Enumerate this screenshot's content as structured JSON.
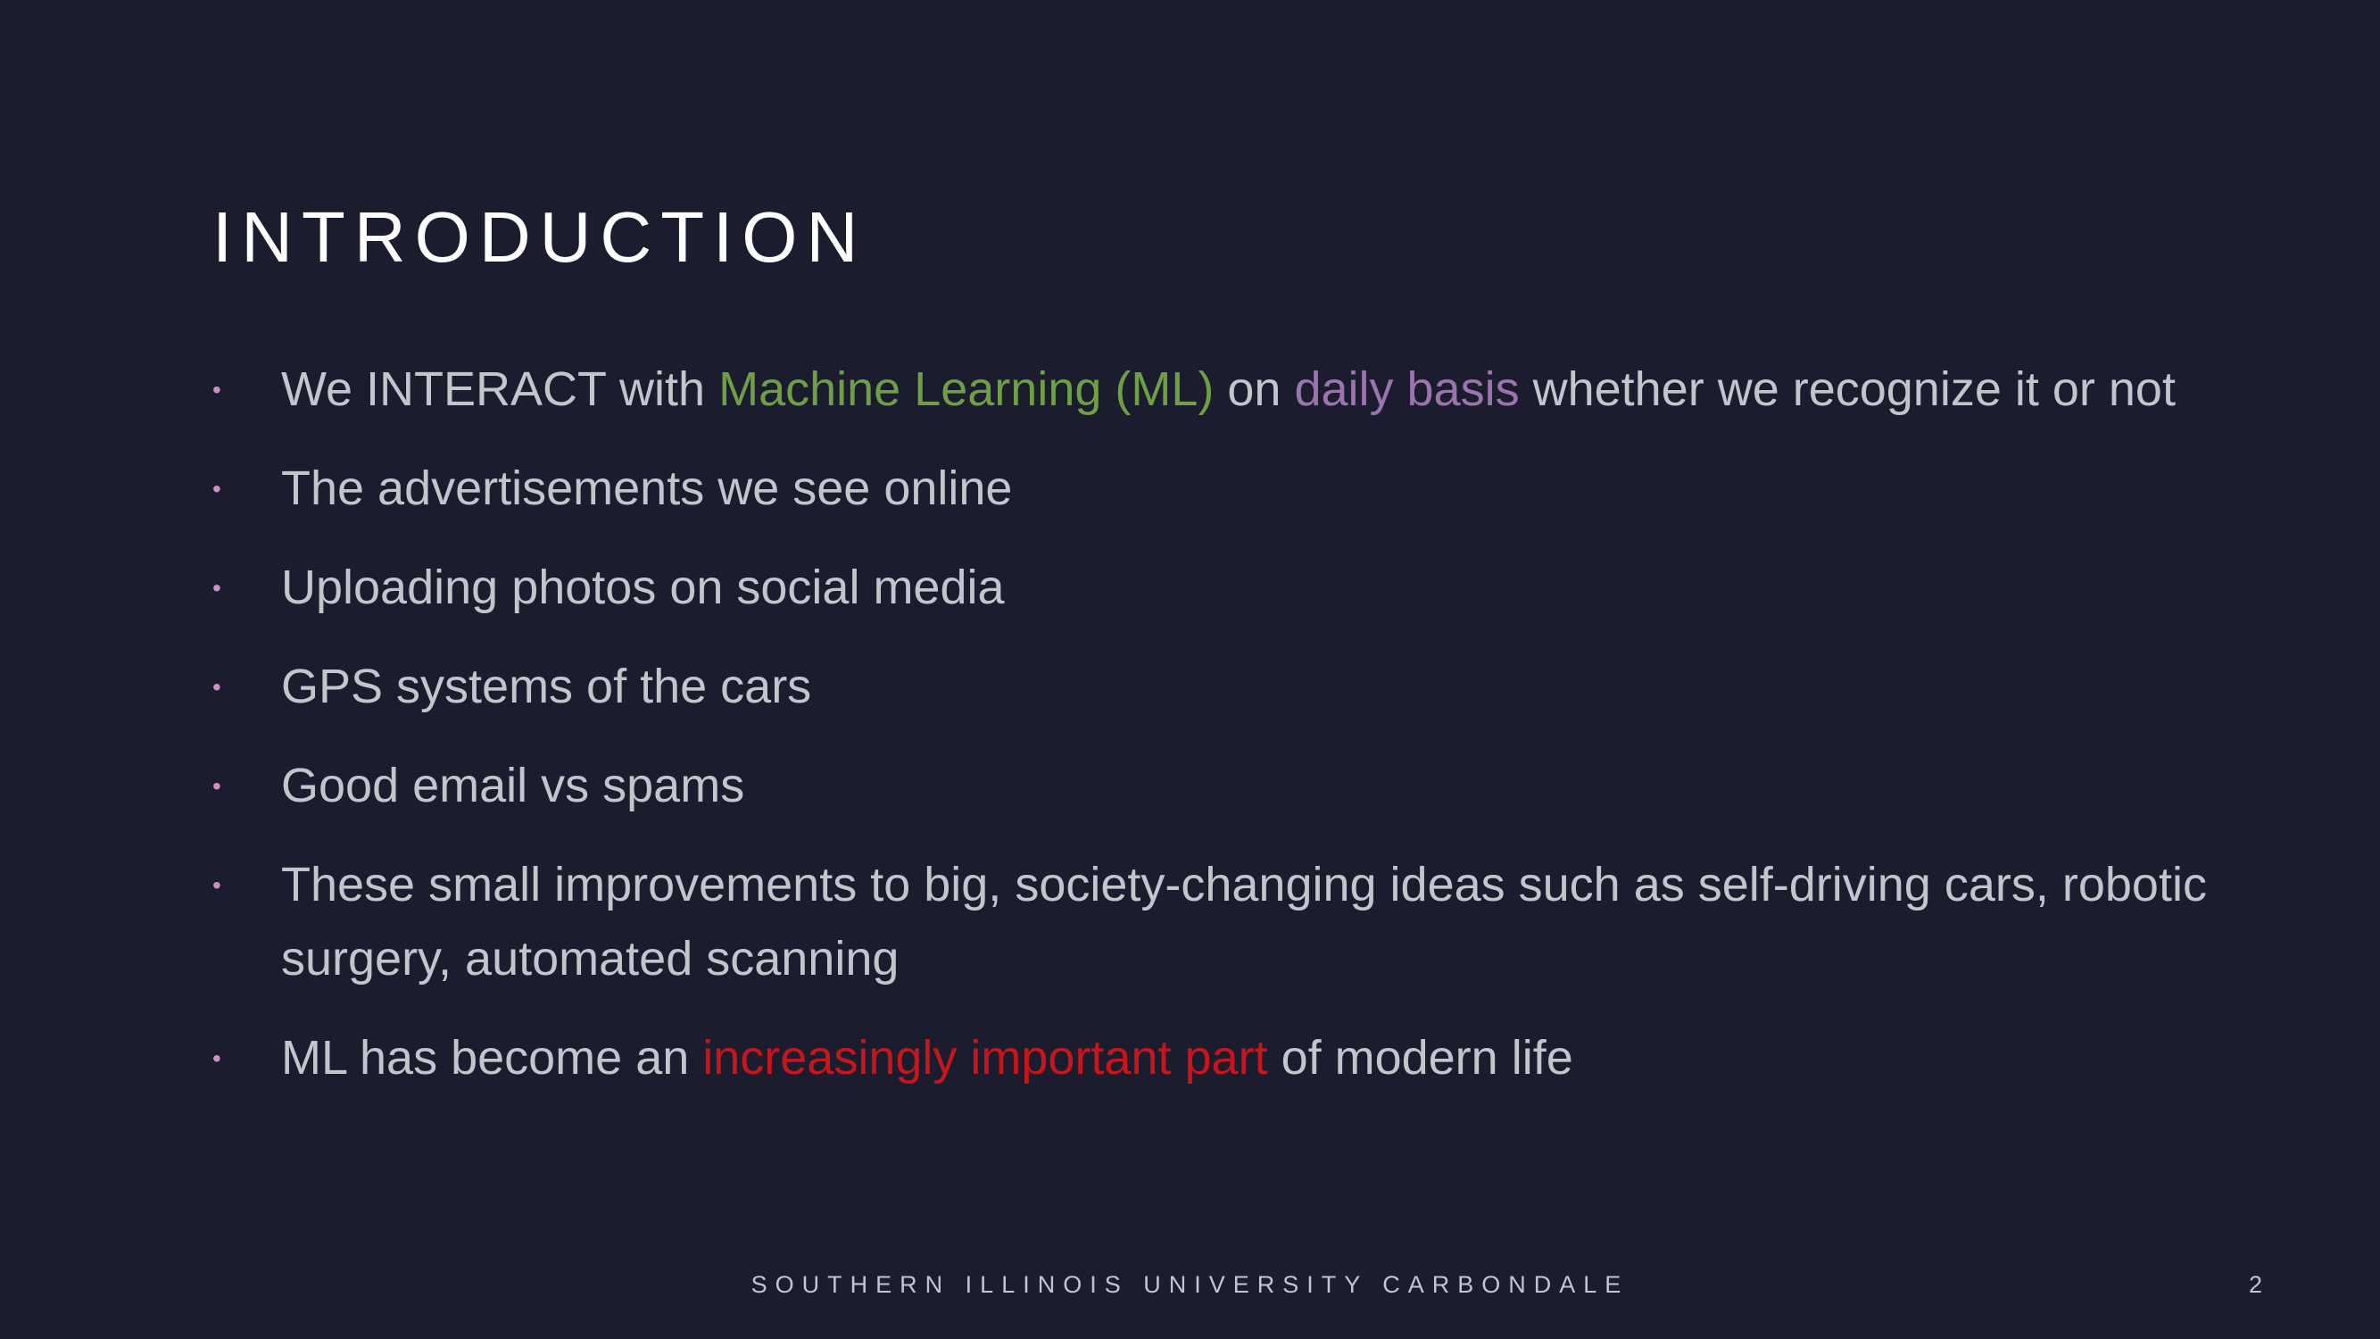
{
  "slide": {
    "title": "INTRODUCTION",
    "bullet_marker": "•",
    "bullets": [
      {
        "t1": "We INTERACT with ",
        "h1": "Machine Learning (ML)",
        "t2": " on ",
        "h2": "daily basis",
        "t3": " whether we recognize it or not"
      },
      {
        "text": "The advertisements we see online"
      },
      {
        "text": "Uploading photos on social media"
      },
      {
        "text": "GPS systems of the cars"
      },
      {
        "text": "Good email vs spams"
      },
      {
        "text": "These small improvements to big, society-changing ideas such as self-driving cars, robotic surgery, automated scanning"
      },
      {
        "t1": "ML has become an ",
        "h1": "increasingly important part",
        "t2": " of modern life"
      }
    ],
    "footer": "SOUTHERN ILLINOIS UNIVERSITY CARBONDALE",
    "page_number": "2"
  },
  "colors": {
    "background": "#1b1d2e",
    "title": "#ffffff",
    "body_text": "#c4c5cc",
    "bullet_marker": "#cf8fc4",
    "highlight_green": "#6f9e45",
    "highlight_purple": "#9a75ad",
    "highlight_red": "#c8151c"
  }
}
